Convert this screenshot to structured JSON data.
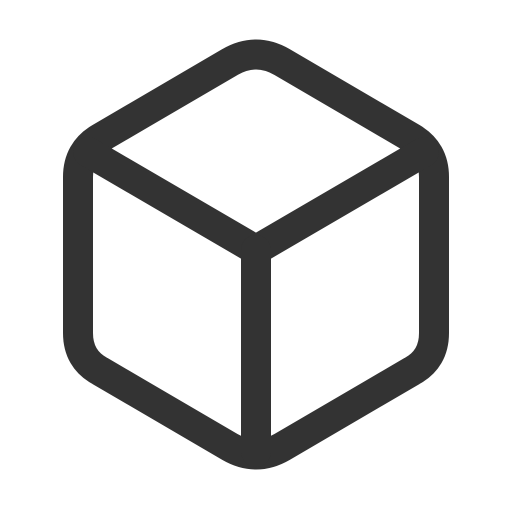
{
  "icon": {
    "name": "cube-icon",
    "stroke_color": "#333333",
    "background_color": "#ffffff"
  }
}
